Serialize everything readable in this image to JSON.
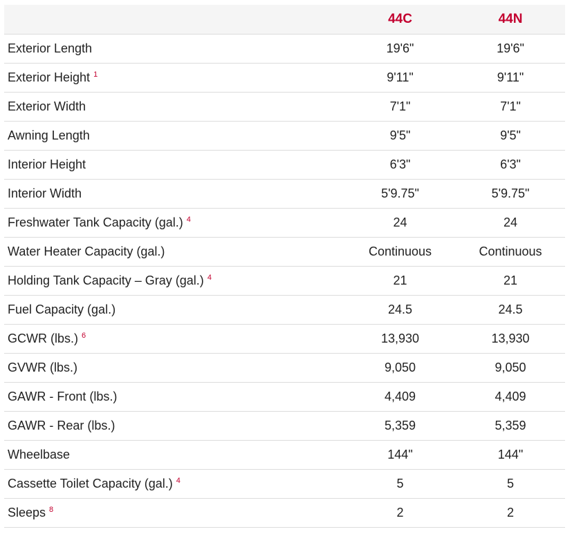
{
  "models": [
    "44C",
    "44N"
  ],
  "rows": [
    {
      "label": "Exterior Length",
      "footnote": "",
      "values": [
        "19'6\"",
        "19'6\""
      ]
    },
    {
      "label": "Exterior Height",
      "footnote": "1",
      "values": [
        "9'11\"",
        "9'11\""
      ]
    },
    {
      "label": "Exterior Width",
      "footnote": "",
      "values": [
        "7'1\"",
        "7'1\""
      ]
    },
    {
      "label": "Awning Length",
      "footnote": "",
      "values": [
        "9'5\"",
        "9'5\""
      ]
    },
    {
      "label": "Interior Height",
      "footnote": "",
      "values": [
        "6'3\"",
        "6'3\""
      ]
    },
    {
      "label": "Interior Width",
      "footnote": "",
      "values": [
        "5'9.75\"",
        "5'9.75\""
      ]
    },
    {
      "label": "Freshwater Tank Capacity (gal.)",
      "footnote": "4",
      "values": [
        "24",
        "24"
      ]
    },
    {
      "label": "Water Heater Capacity (gal.)",
      "footnote": "",
      "values": [
        "Continuous",
        "Continuous"
      ]
    },
    {
      "label": "Holding Tank Capacity – Gray (gal.)",
      "footnote": "4",
      "values": [
        "21",
        "21"
      ]
    },
    {
      "label": "Fuel Capacity (gal.)",
      "footnote": "",
      "values": [
        "24.5",
        "24.5"
      ]
    },
    {
      "label": "GCWR (lbs.)",
      "footnote": "6",
      "values": [
        "13,930",
        "13,930"
      ]
    },
    {
      "label": "GVWR (lbs.)",
      "footnote": "",
      "values": [
        "9,050",
        "9,050"
      ]
    },
    {
      "label": "GAWR - Front (lbs.)",
      "footnote": "",
      "values": [
        "4,409",
        "4,409"
      ]
    },
    {
      "label": "GAWR - Rear (lbs.)",
      "footnote": "",
      "values": [
        "5,359",
        "5,359"
      ]
    },
    {
      "label": "Wheelbase",
      "footnote": "",
      "values": [
        "144\"",
        "144\""
      ]
    },
    {
      "label": "Cassette Toilet Capacity (gal.)",
      "footnote": "4",
      "values": [
        "5",
        "5"
      ]
    },
    {
      "label": "Sleeps",
      "footnote": "8",
      "values": [
        "2",
        "2"
      ]
    }
  ],
  "colors": {
    "accent": "#c3002f",
    "header_bg": "#f5f5f5",
    "row_divider": "#dcdcdc",
    "text": "#222222"
  }
}
